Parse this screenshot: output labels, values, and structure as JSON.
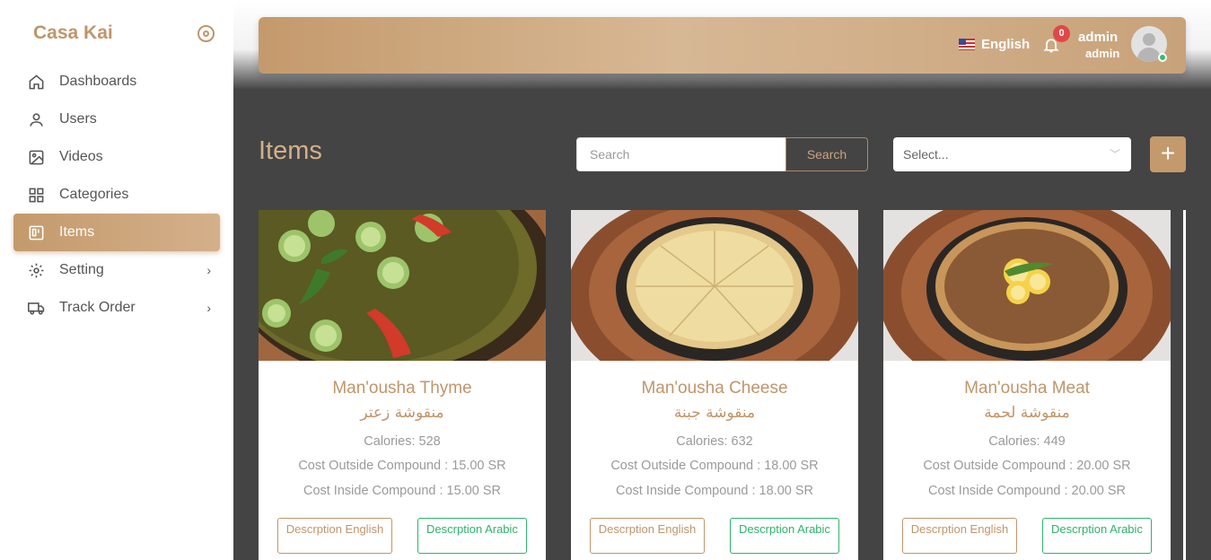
{
  "sidebar": {
    "brand": "Casa Kai",
    "items": [
      {
        "label": "Dashboards",
        "icon": "home-icon"
      },
      {
        "label": "Users",
        "icon": "user-icon"
      },
      {
        "label": "Videos",
        "icon": "image-icon"
      },
      {
        "label": "Categories",
        "icon": "grid-icon"
      },
      {
        "label": "Items",
        "icon": "item-icon",
        "active": true
      },
      {
        "label": "Setting",
        "icon": "gear-icon",
        "has_submenu": true
      },
      {
        "label": "Track Order",
        "icon": "truck-icon",
        "has_submenu": true
      }
    ]
  },
  "navbar": {
    "language": "English",
    "notifications_count": "0",
    "user_name": "admin",
    "user_role": "admin"
  },
  "page": {
    "title": "Items",
    "search_placeholder": "Search",
    "search_button": "Search",
    "select_placeholder": "Select...",
    "add_button": "+"
  },
  "items": [
    {
      "name": "Man'ousha Thyme",
      "name_ar": "منقوشة زعتر",
      "calories": "Calories: 528",
      "cost_outside": "Cost Outside Compound : 15.00 SR",
      "cost_inside": "Cost Inside Compound : 15.00 SR",
      "btn_english": "Descrption English",
      "btn_arabic": "Descrption Arabic"
    },
    {
      "name": "Man'ousha Cheese",
      "name_ar": "منقوشة جبنة",
      "calories": "Calories: 632",
      "cost_outside": "Cost Outside Compound : 18.00 SR",
      "cost_inside": "Cost Inside Compound : 18.00 SR",
      "btn_english": "Descrption English",
      "btn_arabic": "Descrption Arabic"
    },
    {
      "name": "Man'ousha Meat",
      "name_ar": "منقوشة لحمة",
      "calories": "Calories: 449",
      "cost_outside": "Cost Outside Compound : 20.00 SR",
      "cost_inside": "Cost Inside Compound : 20.00 SR",
      "btn_english": "Descrption English",
      "btn_arabic": "Descrption Arabic"
    }
  ],
  "colors": {
    "accent": "#c0956a",
    "green": "#2eb36a",
    "badge": "#e04848",
    "dark_bg": "#444444"
  }
}
